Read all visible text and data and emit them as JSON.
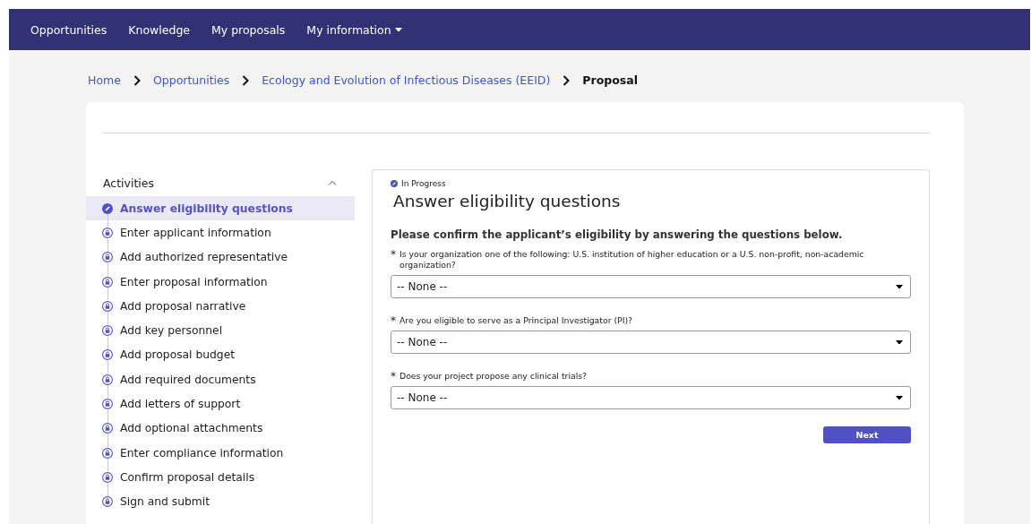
{
  "nav": {
    "items": [
      {
        "label": "Opportunities",
        "dropdown": false
      },
      {
        "label": "Knowledge",
        "dropdown": false
      },
      {
        "label": "My proposals",
        "dropdown": false
      },
      {
        "label": "My information",
        "dropdown": true
      }
    ]
  },
  "breadcrumb": [
    {
      "label": "Home",
      "current": false
    },
    {
      "label": "Opportunities",
      "current": false
    },
    {
      "label": "Ecology and Evolution of Infectious Diseases (EEID)",
      "current": false
    },
    {
      "label": "Proposal",
      "current": true
    }
  ],
  "activities": {
    "title": "Activities",
    "expanded": true,
    "items": [
      {
        "label": "Answer eligibility questions",
        "kind": "in_progress",
        "selected": true
      },
      {
        "label": "Enter applicant information",
        "kind": "locked",
        "selected": false
      },
      {
        "label": "Add authorized representative",
        "kind": "locked",
        "selected": false
      },
      {
        "label": "Enter proposal information",
        "kind": "locked",
        "selected": false
      },
      {
        "label": "Add proposal narrative",
        "kind": "locked",
        "selected": false
      },
      {
        "label": "Add key personnel",
        "kind": "locked",
        "selected": false
      },
      {
        "label": "Add proposal budget",
        "kind": "locked",
        "selected": false
      },
      {
        "label": "Add required documents",
        "kind": "locked",
        "selected": false
      },
      {
        "label": "Add letters of support",
        "kind": "locked",
        "selected": false
      },
      {
        "label": "Add optional attachments",
        "kind": "locked",
        "selected": false
      },
      {
        "label": "Enter compliance information",
        "kind": "locked",
        "selected": false
      },
      {
        "label": "Confirm proposal details",
        "kind": "locked",
        "selected": false
      },
      {
        "label": "Sign and submit",
        "kind": "locked",
        "selected": false
      }
    ]
  },
  "form": {
    "status": "In Progress",
    "title": "Answer eligibility questions",
    "intro": "Please confirm the applicant’s eligibility by answering the questions below.",
    "questions": [
      {
        "marker": "*",
        "label": "Is your organization one of the following: U.S. institution of higher education or a U.S. non-profit, non-academic organization?",
        "value": "-- None --"
      },
      {
        "marker": "*",
        "label": "Are you eligible to serve as a Principal Investigator (PI)?",
        "value": "-- None --"
      },
      {
        "marker": "*",
        "label": "Does your project propose any clinical trials?",
        "value": "-- None --"
      }
    ],
    "button": "Next"
  }
}
